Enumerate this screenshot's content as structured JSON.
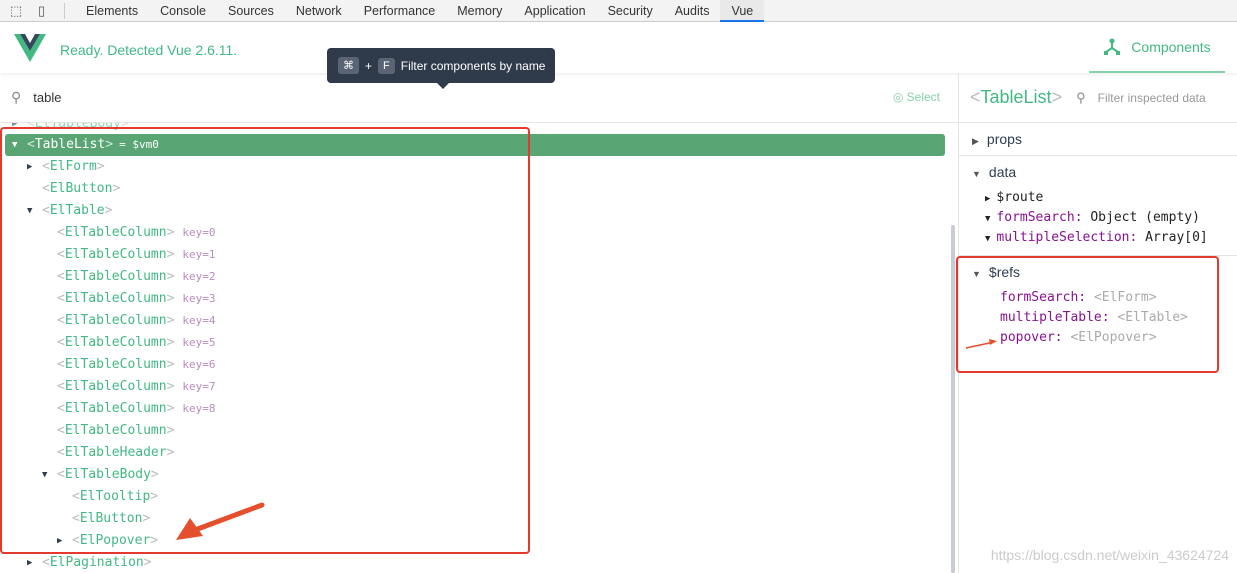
{
  "devtools_tabs": [
    "Elements",
    "Console",
    "Sources",
    "Network",
    "Performance",
    "Memory",
    "Application",
    "Security",
    "Audits",
    "Vue"
  ],
  "active_tab": "Vue",
  "header": {
    "status": "Ready. Detected Vue 2.6.11.",
    "components_tab": "Components"
  },
  "tooltip": {
    "key1": "⌘",
    "plus": "+",
    "key2": "F",
    "text": "Filter components by name"
  },
  "search": {
    "value": "table",
    "select_label": "Select"
  },
  "tree": [
    {
      "depth": 0,
      "name": "ElTableBody",
      "arrow": "closed",
      "partial": true
    },
    {
      "depth": 0,
      "name": "TableList",
      "arrow": "open",
      "selected": true,
      "vm": "= $vm0"
    },
    {
      "depth": 1,
      "name": "ElForm",
      "arrow": "closed"
    },
    {
      "depth": 1,
      "name": "ElButton"
    },
    {
      "depth": 1,
      "name": "ElTable",
      "arrow": "open"
    },
    {
      "depth": 2,
      "name": "ElTableColumn",
      "key": "key=0"
    },
    {
      "depth": 2,
      "name": "ElTableColumn",
      "key": "key=1"
    },
    {
      "depth": 2,
      "name": "ElTableColumn",
      "key": "key=2"
    },
    {
      "depth": 2,
      "name": "ElTableColumn",
      "key": "key=3"
    },
    {
      "depth": 2,
      "name": "ElTableColumn",
      "key": "key=4"
    },
    {
      "depth": 2,
      "name": "ElTableColumn",
      "key": "key=5"
    },
    {
      "depth": 2,
      "name": "ElTableColumn",
      "key": "key=6"
    },
    {
      "depth": 2,
      "name": "ElTableColumn",
      "key": "key=7"
    },
    {
      "depth": 2,
      "name": "ElTableColumn",
      "key": "key=8"
    },
    {
      "depth": 2,
      "name": "ElTableColumn"
    },
    {
      "depth": 2,
      "name": "ElTableHeader"
    },
    {
      "depth": 2,
      "name": "ElTableBody",
      "arrow": "open"
    },
    {
      "depth": 3,
      "name": "ElTooltip"
    },
    {
      "depth": 3,
      "name": "ElButton"
    },
    {
      "depth": 3,
      "name": "ElPopover",
      "arrow": "closed"
    },
    {
      "depth": 1,
      "name": "ElPagination",
      "arrow": "closed"
    }
  ],
  "inspector": {
    "component": "TableList",
    "filter_placeholder": "Filter inspected data",
    "props_label": "props",
    "data_label": "data",
    "data": [
      {
        "key": "$route",
        "arrow": "closed",
        "plain": true
      },
      {
        "key": "formSearch",
        "value": "Object (empty)",
        "arrow": "open"
      },
      {
        "key": "multipleSelection",
        "value": "Array[0]",
        "arrow": "open"
      }
    ],
    "refs_label": "$refs",
    "refs": [
      {
        "key": "formSearch",
        "value": "<ElForm>"
      },
      {
        "key": "multipleTable",
        "value": "<ElTable>"
      },
      {
        "key": "popover",
        "value": "<ElPopover>"
      }
    ]
  },
  "watermark": "https://blog.csdn.net/weixin_43624724",
  "colors": {
    "vue_green": "#42b983",
    "selected_row": "#5aa574",
    "annotation_red": "#e4392c"
  }
}
